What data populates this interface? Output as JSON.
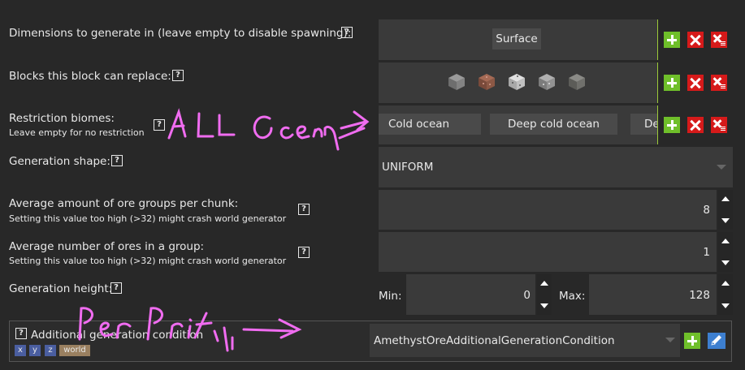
{
  "dimensions": {
    "label": "Dimensions to generate in (leave empty to disable spawning):",
    "items": [
      "Surface"
    ]
  },
  "blocks": {
    "label": "Blocks this block can replace:",
    "icons": [
      "stone-block-icon",
      "granite-block-icon",
      "diorite-block-icon",
      "andesite-block-icon",
      "tuff-block-icon"
    ]
  },
  "biomes": {
    "label": "Restriction biomes:",
    "sublabel": "Leave empty for no restriction",
    "items": [
      "Cold ocean",
      "Deep cold ocean",
      "De"
    ]
  },
  "shape": {
    "label": "Generation shape:",
    "value": "UNIFORM"
  },
  "groups": {
    "label": "Average amount of ore groups per chunk:",
    "sublabel": "Setting this value too high (>32) might crash world generator",
    "value": "8"
  },
  "ores": {
    "label": "Average number of ores in a group:",
    "sublabel": "Setting this value too high (>32) might crash world generator",
    "value": "1"
  },
  "height": {
    "label": "Generation height:",
    "min_label": "Min:",
    "min_value": "0",
    "max_label": "Max:",
    "max_value": "128"
  },
  "condition": {
    "label": "Additional generation condition",
    "tags": [
      "x",
      "y",
      "z",
      "world"
    ],
    "value": "AmethystOreAdditionalGenerationCondition"
  },
  "annotations": {
    "ocean": "ALL Ocean",
    "perpoint": "Per Point"
  },
  "help_glyph": "?",
  "colors": {
    "background": "#282828",
    "panel": "#3a3a3a",
    "add_button": "#6fbf2a",
    "delete_button": "#d61a1a",
    "tag_blue": "#4a5ea0",
    "tag_brown": "#9a8060",
    "handwriting": "#f06cf0"
  }
}
